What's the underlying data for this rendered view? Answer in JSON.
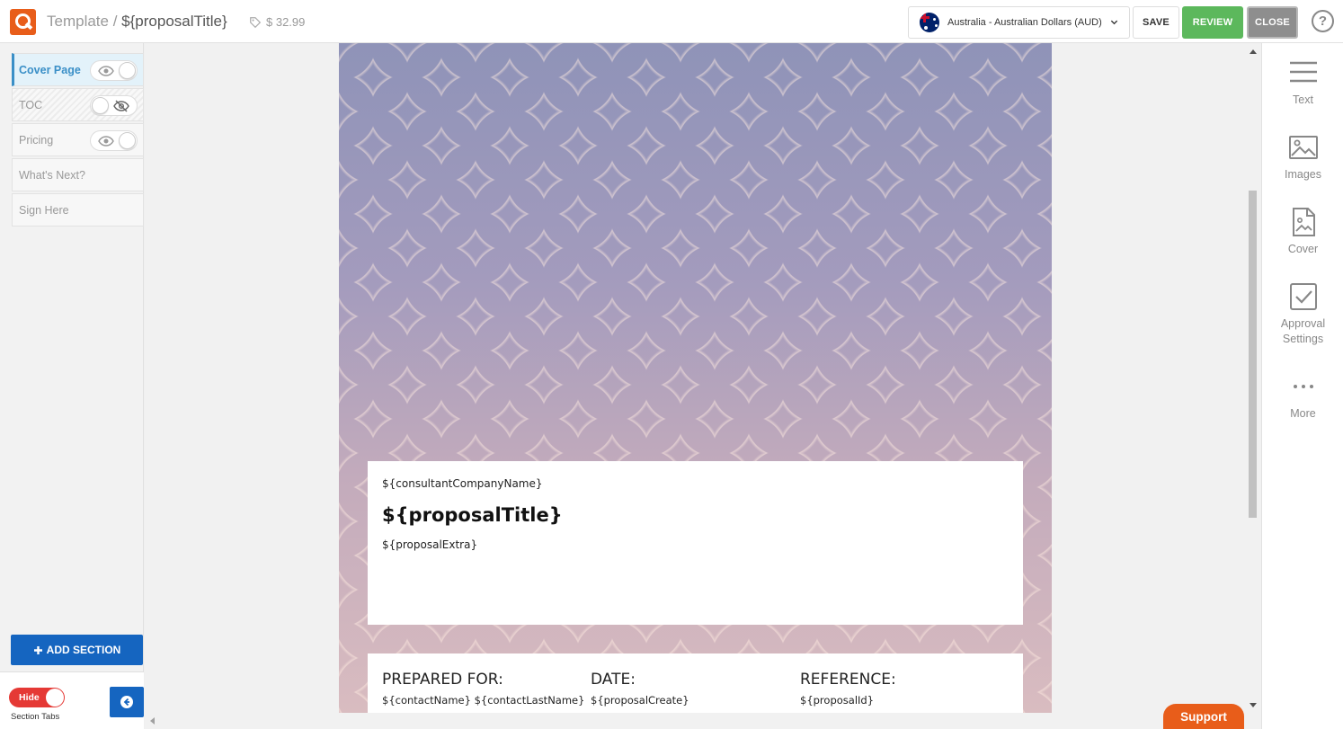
{
  "header": {
    "breadcrumb_root": "Template",
    "breadcrumb_sep": " / ",
    "proposal_title": "${proposalTitle}",
    "price": "$ 32.99",
    "currency": "Australia - Australian Dollars (AUD)",
    "save_label": "SAVE",
    "review_label": "REVIEW",
    "close_label": "CLOSE",
    "help_label": "?"
  },
  "colors": {
    "brand": "#e85d1a",
    "review": "#5cb85c",
    "primary": "#1565c0",
    "active_section": "#3a8fc7",
    "hide_toggle": "#e53935"
  },
  "sections": [
    {
      "label": "Cover Page",
      "visible": true,
      "active": true
    },
    {
      "label": "TOC",
      "visible": false,
      "active": false
    },
    {
      "label": "Pricing",
      "visible": true,
      "active": false
    },
    {
      "label": "What's Next?",
      "active": false
    },
    {
      "label": "Sign Here",
      "active": false
    }
  ],
  "sidebar": {
    "add_section": "ADD SECTION",
    "hide_toggle": "Hide",
    "hide_caption": "Section Tabs"
  },
  "cover": {
    "company": "${consultantCompanyName}",
    "title": "${proposalTitle}",
    "extra": "${proposalExtra}"
  },
  "info": {
    "prepared_for_label": "PREPARED FOR:",
    "prepared_for_value": "${contactName} ${contactLastName}",
    "date_label": "DATE:",
    "date_value": "${proposalCreate}",
    "reference_label": "REFERENCE:",
    "reference_value": "${proposalId}"
  },
  "tools": [
    {
      "label": "Text",
      "icon": "text-lines-icon"
    },
    {
      "label": "Images",
      "icon": "image-icon"
    },
    {
      "label": "Cover",
      "icon": "cover-icon"
    },
    {
      "label": "Approval Settings",
      "icon": "checkbox-icon"
    },
    {
      "label": "More",
      "icon": "more-dots-icon"
    }
  ],
  "support_label": "Support"
}
